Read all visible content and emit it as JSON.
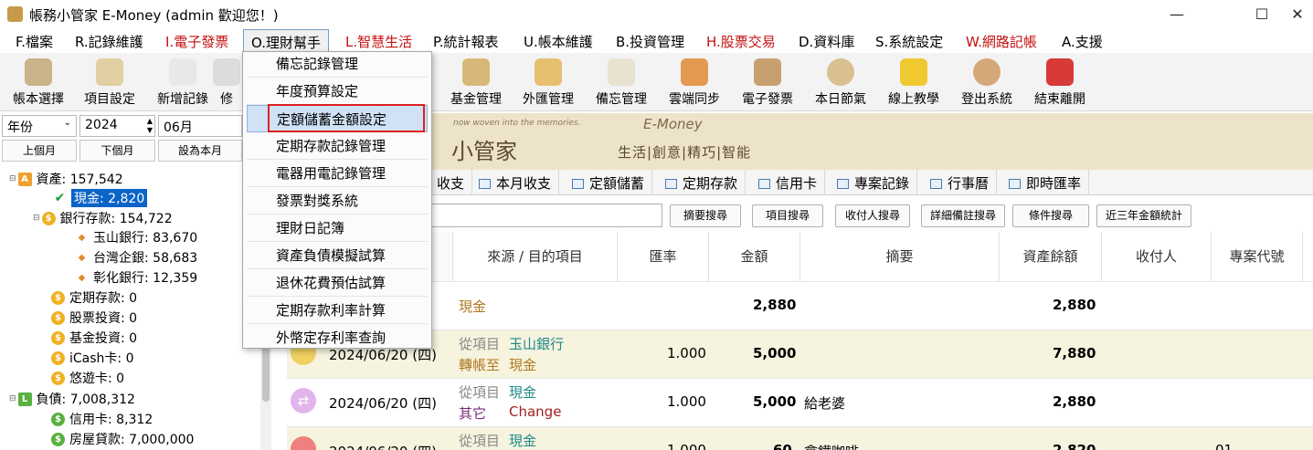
{
  "window": {
    "title": "帳務小管家 E-Money (admin 歡迎您！)",
    "min_glyph": "—",
    "max_glyph": "☐",
    "close_glyph": "✕"
  },
  "menubar": [
    {
      "label": "F.檔案"
    },
    {
      "label": "R.記錄維護"
    },
    {
      "label": "I.電子發票"
    },
    {
      "label": "O.理財幫手"
    },
    {
      "label": "L.智慧生活"
    },
    {
      "label": "P.統計報表"
    },
    {
      "label": "U.帳本維護"
    },
    {
      "label": "B.投資管理"
    },
    {
      "label": "H.股票交易"
    },
    {
      "label": "D.資料庫"
    },
    {
      "label": "S.系統設定"
    },
    {
      "label": "W.網路記帳"
    },
    {
      "label": "A.支援"
    }
  ],
  "toolbar": [
    {
      "label": "帳本選擇",
      "icon": "ledger-icon"
    },
    {
      "label": "項目設定",
      "icon": "settings-doc-icon"
    },
    {
      "label": "新增記錄",
      "icon": "add-record-icon"
    },
    {
      "label": "修",
      "icon": "edit-icon"
    },
    {
      "label": "基金管理",
      "icon": "fund-icon"
    },
    {
      "label": "外匯管理",
      "icon": "forex-icon"
    },
    {
      "label": "備忘管理",
      "icon": "memo-icon"
    },
    {
      "label": "雲端同步",
      "icon": "cloud-sync-icon"
    },
    {
      "label": "電子發票",
      "icon": "qrcode-icon"
    },
    {
      "label": "本日節氣",
      "icon": "solar-term-icon"
    },
    {
      "label": "線上教學",
      "icon": "help-icon"
    },
    {
      "label": "登出系統",
      "icon": "logout-icon"
    },
    {
      "label": "結束離開",
      "icon": "exit-icon"
    }
  ],
  "filters": {
    "year_mode": "年份",
    "year": "2024",
    "month": "06月",
    "prev": "上個月",
    "next": "下個月",
    "set_current": "設為本月"
  },
  "tree": [
    {
      "label": "資產: 157,542",
      "badge": "A"
    },
    {
      "label": "現金: 2,820",
      "badge": "✔"
    },
    {
      "label": "銀行存款: 154,722",
      "badge": "$"
    },
    {
      "label": "玉山銀行: 83,670",
      "badge": "◆"
    },
    {
      "label": "台灣企銀: 58,683",
      "badge": "◆"
    },
    {
      "label": "彰化銀行: 12,359",
      "badge": "◆"
    },
    {
      "label": "定期存款: 0",
      "badge": "$"
    },
    {
      "label": "股票投資: 0",
      "badge": "$"
    },
    {
      "label": "基金投資: 0",
      "badge": "$"
    },
    {
      "label": "iCash卡: 0",
      "badge": "$"
    },
    {
      "label": "悠遊卡: 0",
      "badge": "$"
    },
    {
      "label": "負債: 7,008,312",
      "badge": "L"
    },
    {
      "label": "信用卡: 8,312",
      "badge": "$"
    },
    {
      "label": "房屋貸款: 7,000,000",
      "badge": "$"
    }
  ],
  "banner": {
    "slogan": "now woven into the memories.",
    "brand": "E-Money",
    "name": "小管家",
    "motto": "生活|創意|精巧|智能"
  },
  "tabs": [
    {
      "label": "收支"
    },
    {
      "label": "本月收支"
    },
    {
      "label": "定額儲蓄"
    },
    {
      "label": "定期存款"
    },
    {
      "label": "信用卡"
    },
    {
      "label": "專案記錄"
    },
    {
      "label": "行事曆"
    },
    {
      "label": "即時匯率"
    }
  ],
  "search_buttons": [
    {
      "label": "摘要搜尋"
    },
    {
      "label": "項目搜尋"
    },
    {
      "label": "收付人搜尋"
    },
    {
      "label": "詳細備註搜尋"
    },
    {
      "label": "條件搜尋"
    },
    {
      "label": "近三年金額統計"
    }
  ],
  "grid": {
    "headers": [
      "來源 / 目的項目",
      "匯率",
      "金額",
      "摘要",
      "資產餘額",
      "收付人",
      "專案代號"
    ],
    "rows": [
      {
        "date": "",
        "src_label": "",
        "src": "現金",
        "dst_label": "",
        "dst": "",
        "rate": "",
        "amount": "2,880",
        "memo": "",
        "balance": "2,880",
        "project": ""
      },
      {
        "date": "2024/06/20 (四)",
        "src_label": "從項目",
        "src": "玉山銀行",
        "dst_label": "轉帳至",
        "dst": "現金",
        "rate": "1.000",
        "amount": "5,000",
        "memo": "",
        "balance": "7,880",
        "project": ""
      },
      {
        "date": "2024/06/20 (四)",
        "src_label": "從項目",
        "src": "現金",
        "dst_label": "其它",
        "dst": "Change",
        "rate": "1.000",
        "amount": "5,000",
        "memo": "給老婆",
        "balance": "2,880",
        "project": ""
      },
      {
        "date": "2024/06/20 (四)",
        "src_label": "從項目",
        "src": "現金",
        "dst_label": "",
        "dst": "",
        "rate": "1.000",
        "amount": "60",
        "memo": "拿鐵咖啡",
        "balance": "2,820",
        "project": "01"
      }
    ]
  },
  "dropdown": [
    {
      "label": "備忘記錄管理"
    },
    {
      "label": "年度預算設定"
    },
    {
      "label": "定額儲蓄金額設定"
    },
    {
      "label": "定期存款記錄管理"
    },
    {
      "label": "電器用電記錄管理"
    },
    {
      "label": "發票對獎系統"
    },
    {
      "label": "理財日記簿"
    },
    {
      "label": "資產負債模擬試算"
    },
    {
      "label": "退休花費預估試算"
    },
    {
      "label": "定期存款利率計算"
    },
    {
      "label": "外幣定存利率查詢"
    }
  ]
}
